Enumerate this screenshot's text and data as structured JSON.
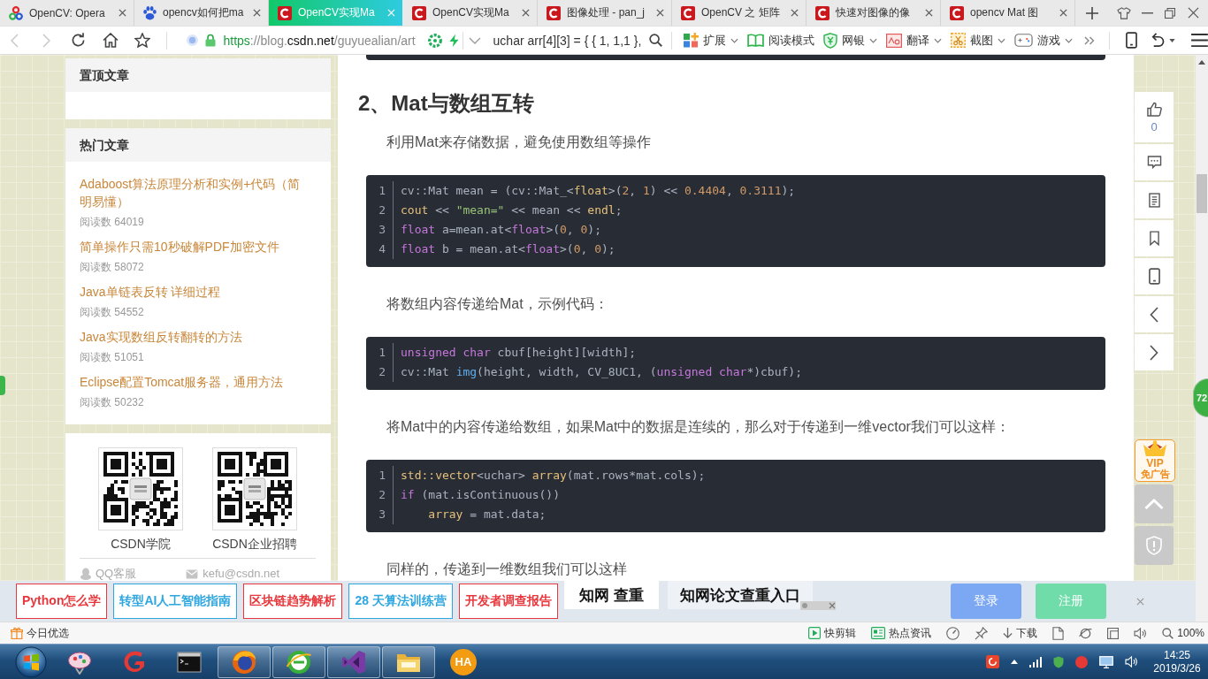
{
  "browser": {
    "tabs": [
      {
        "title": "OpenCV: Opera",
        "kind": "opencv",
        "selected": false
      },
      {
        "title": "opencv如何把ma",
        "kind": "paw",
        "selected": false
      },
      {
        "title": "OpenCV实现Ma",
        "kind": "csdn",
        "selected": true
      },
      {
        "title": "OpenCV实现Ma",
        "kind": "csdn",
        "selected": false
      },
      {
        "title": "图像处理 - pan_j",
        "kind": "csdn",
        "selected": false
      },
      {
        "title": "OpenCV 之 矩阵",
        "kind": "csdn",
        "selected": false
      },
      {
        "title": "快速对图像的像",
        "kind": "csdn",
        "selected": false
      },
      {
        "title": "opencv Mat 图",
        "kind": "csdn",
        "selected": false
      }
    ],
    "nav_buttons": [
      {
        "kind": "back",
        "disabled": true
      },
      {
        "kind": "forward",
        "disabled": true
      },
      {
        "kind": "reload",
        "disabled": false
      },
      {
        "kind": "home",
        "disabled": false
      },
      {
        "kind": "star",
        "disabled": false
      }
    ],
    "url": [
      {
        "text": "https",
        "kind": "scheme"
      },
      {
        "text": "://blog.",
        "kind": "dim"
      },
      {
        "text": "csdn.net",
        "kind": "domain"
      },
      {
        "text": "/guyuealian/art",
        "kind": "dim"
      }
    ],
    "search": {
      "value": "uchar arr[4][3] = { { 1, 1,1 },"
    },
    "tools": [
      {
        "kind": "apps",
        "label": "扩展",
        "dropdown": true
      },
      {
        "kind": "book",
        "label": "阅读模式",
        "dropdown": false
      },
      {
        "kind": "bank",
        "label": "网银",
        "dropdown": true
      },
      {
        "kind": "translate",
        "label": "翻译",
        "dropdown": true
      },
      {
        "kind": "screenshot",
        "label": "截图",
        "dropdown": true
      },
      {
        "kind": "gamepad",
        "label": "游戏",
        "dropdown": true
      }
    ]
  },
  "sidebar": {
    "cards": [
      {
        "title": "置顶文章"
      },
      {
        "title": "热门文章",
        "articles": [
          {
            "title": "Adaboost算法原理分析和实例+代码（简明易懂）",
            "reads": "阅读数 64019"
          },
          {
            "title": "简单操作只需10秒破解PDF加密文件",
            "reads": "阅读数 58072"
          },
          {
            "title": "Java单链表反转 详细过程",
            "reads": "阅读数 54552"
          },
          {
            "title": "Java实现数组反转翻转的方法",
            "reads": "阅读数 51051"
          },
          {
            "title": "Eclipse配置Tomcat服务器，通用方法",
            "reads": "阅读数 50232"
          }
        ]
      }
    ],
    "qr_codes": [
      {
        "caption": "CSDN学院"
      },
      {
        "caption": "CSDN企业招聘"
      }
    ],
    "contacts": [
      {
        "kind": "qq",
        "text": "QQ客服"
      },
      {
        "kind": "mail",
        "text": "kefu@csdn.net"
      }
    ]
  },
  "article": {
    "blocks": [
      {
        "kind": "code_tail"
      },
      {
        "kind": "heading",
        "text": "2、Mat与数组互转"
      },
      {
        "kind": "paragraph",
        "text": "利用Mat来存储数据，避免使用数组等操作"
      },
      {
        "kind": "code",
        "lines": [
          {
            "number": "1",
            "tokens": [
              {
                "text": "cv::Mat mean = (cv::Mat_<",
                "kind": "plain"
              },
              {
                "text": "float",
                "kind": "type"
              },
              {
                "text": ">(",
                "kind": "plain"
              },
              {
                "text": "2",
                "kind": "number"
              },
              {
                "text": ", ",
                "kind": "plain"
              },
              {
                "text": "1",
                "kind": "number"
              },
              {
                "text": ") << ",
                "kind": "plain"
              },
              {
                "text": "0.4404",
                "kind": "number"
              },
              {
                "text": ", ",
                "kind": "plain"
              },
              {
                "text": "0.3111",
                "kind": "number"
              },
              {
                "text": ");",
                "kind": "plain"
              }
            ]
          },
          {
            "number": "2",
            "tokens": [
              {
                "text": "cout",
                "kind": "builtin"
              },
              {
                "text": " << ",
                "kind": "plain"
              },
              {
                "text": "\"mean=\"",
                "kind": "string"
              },
              {
                "text": " << mean << ",
                "kind": "plain"
              },
              {
                "text": "endl",
                "kind": "builtin"
              },
              {
                "text": ";",
                "kind": "plain"
              }
            ]
          },
          {
            "number": "3",
            "tokens": [
              {
                "text": "float",
                "kind": "keyword"
              },
              {
                "text": " a=mean.at<",
                "kind": "plain"
              },
              {
                "text": "float",
                "kind": "keyword"
              },
              {
                "text": ">(",
                "kind": "plain"
              },
              {
                "text": "0",
                "kind": "number"
              },
              {
                "text": ", ",
                "kind": "plain"
              },
              {
                "text": "0",
                "kind": "number"
              },
              {
                "text": ");",
                "kind": "plain"
              }
            ]
          },
          {
            "number": "4",
            "tokens": [
              {
                "text": "float",
                "kind": "keyword"
              },
              {
                "text": " b = mean.at<",
                "kind": "plain"
              },
              {
                "text": "float",
                "kind": "keyword"
              },
              {
                "text": ">(",
                "kind": "plain"
              },
              {
                "text": "0",
                "kind": "number"
              },
              {
                "text": ", ",
                "kind": "plain"
              },
              {
                "text": "0",
                "kind": "number"
              },
              {
                "text": ");",
                "kind": "plain"
              }
            ]
          }
        ]
      },
      {
        "kind": "paragraph",
        "text": "将数组内容传递给Mat，示例代码："
      },
      {
        "kind": "code",
        "lines": [
          {
            "number": "1",
            "tokens": [
              {
                "text": "unsigned",
                "kind": "keyword"
              },
              {
                "text": " char",
                "kind": "keyword"
              },
              {
                "text": " cbuf[height][width];",
                "kind": "plain"
              }
            ]
          },
          {
            "number": "2",
            "tokens": [
              {
                "text": "cv::Mat ",
                "kind": "plain"
              },
              {
                "text": "img",
                "kind": "function"
              },
              {
                "text": "(height, width, CV_8UC1, (",
                "kind": "plain"
              },
              {
                "text": "unsigned",
                "kind": "keyword"
              },
              {
                "text": " char",
                "kind": "keyword"
              },
              {
                "text": "*)cbuf);",
                "kind": "plain"
              }
            ]
          }
        ]
      },
      {
        "kind": "paragraph",
        "text": "将Mat中的内容传递给数组，如果Mat中的数据是连续的，那么对于传递到一维vector我们可以这样："
      },
      {
        "kind": "code",
        "lines": [
          {
            "number": "1",
            "tokens": [
              {
                "text": "std::vector",
                "kind": "builtin"
              },
              {
                "text": "<uchar> ",
                "kind": "plain"
              },
              {
                "text": "array",
                "kind": "builtin"
              },
              {
                "text": "(mat.rows*mat.cols);",
                "kind": "plain"
              }
            ]
          },
          {
            "number": "2",
            "tokens": [
              {
                "text": "if",
                "kind": "keyword"
              },
              {
                "text": " (mat.isContinuous())",
                "kind": "plain"
              }
            ]
          },
          {
            "number": "3",
            "tokens": [
              {
                "text": "    array",
                "kind": "builtin"
              },
              {
                "text": " = mat.data;",
                "kind": "plain"
              }
            ]
          }
        ]
      },
      {
        "kind": "paragraph",
        "text": "同样的，传递到一维数组我们可以这样"
      }
    ]
  },
  "side_actions": {
    "buttons": [
      {
        "kind": "like",
        "count": "0"
      },
      {
        "kind": "comment"
      },
      {
        "kind": "contents"
      },
      {
        "kind": "bookmark"
      },
      {
        "kind": "mobile"
      },
      {
        "kind": "previous"
      },
      {
        "kind": "next"
      }
    ],
    "vip": {
      "title": "VIP",
      "caption": "免广告"
    },
    "bottom_buttons": [
      {
        "kind": "top"
      },
      {
        "kind": "report"
      }
    ]
  },
  "float_badge": {
    "text": "72"
  },
  "ad_bar": {
    "links": [
      {
        "text": "Python怎么学",
        "color": "#e8383d"
      },
      {
        "text": "转型AI人工智能指南",
        "color": "#2ea7e0"
      },
      {
        "text": "区块链趋势解析",
        "color": "#e8383d"
      },
      {
        "text": "28 天算法训练营",
        "color": "#2ea7e0"
      },
      {
        "text": "开发者调查报告",
        "color": "#e8383d"
      }
    ],
    "promos": [
      {
        "text": "知网 查重",
        "kind": "boxed"
      },
      {
        "text": "知网论文查重入口",
        "kind": "plain"
      }
    ],
    "buttons": [
      {
        "kind": "login",
        "label": "登录"
      },
      {
        "kind": "register",
        "label": "注册"
      }
    ]
  },
  "status_bar": {
    "label": "今日优选",
    "items": [
      {
        "kind": "clip",
        "label": "快剪辑"
      },
      {
        "kind": "news",
        "label": "热点资讯"
      },
      {
        "kind": "gauge"
      },
      {
        "kind": "pin"
      },
      {
        "kind": "download",
        "label": "下载"
      },
      {
        "kind": "page"
      },
      {
        "kind": "browser"
      },
      {
        "kind": "window"
      },
      {
        "kind": "volume"
      },
      {
        "kind": "zoom",
        "label": "100%"
      }
    ]
  },
  "taskbar": {
    "apps": [
      {
        "kind": "palette",
        "running": false
      },
      {
        "kind": "swirl",
        "running": false
      },
      {
        "kind": "terminal",
        "running": false
      },
      {
        "kind": "globe",
        "running": true
      },
      {
        "kind": "ring",
        "running": true
      },
      {
        "kind": "ribbon",
        "running": true
      },
      {
        "kind": "folder",
        "running": true
      },
      {
        "kind": "badge",
        "label": "HA",
        "running": false
      }
    ],
    "clock": {
      "time": "14:25",
      "date": "2019/3/26"
    }
  }
}
